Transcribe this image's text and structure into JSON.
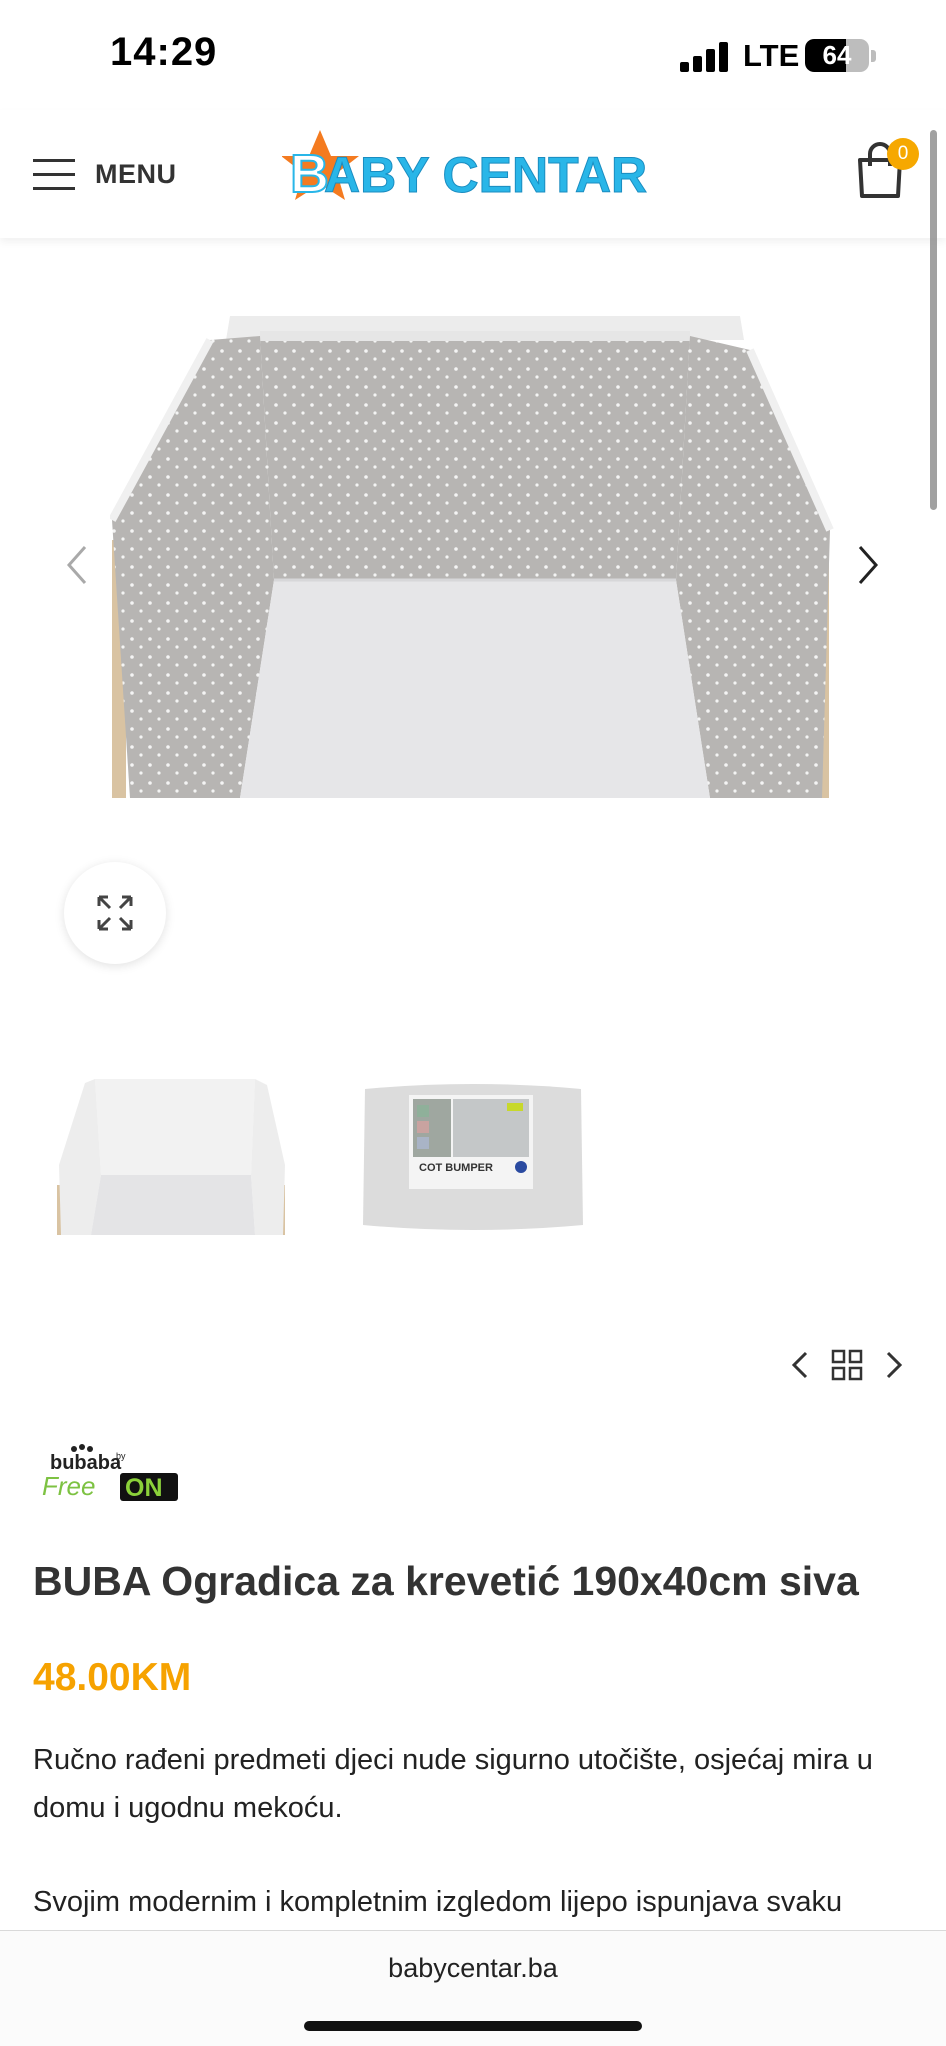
{
  "status_bar": {
    "time": "14:29",
    "network": "LTE",
    "battery": "64",
    "battery_level": 0.64
  },
  "header": {
    "menu_label": "MENU",
    "logo_text": "BABY CENTAR",
    "cart_count": "0",
    "colors": {
      "logo_blue": "#29b6e8",
      "logo_orange": "#f47b20",
      "badge": "#f6a800"
    }
  },
  "gallery": {
    "main_image_alt": "grey crib bumper with white stars",
    "thumbnails": [
      {
        "alt": "white crib bumper"
      },
      {
        "alt": "cot bumper in package",
        "package_label": "COT BUMPER"
      }
    ]
  },
  "product": {
    "brand_logo_text": {
      "top": "bubaba",
      "by": "by",
      "free": "Free",
      "on": "ON"
    },
    "title": "BUBA Ogradica za krevetić 190x40cm siva",
    "price": "48.00KM",
    "description_1": "Ručno rađeni predmeti djeci nude sigurno utočište, osjećaj mira u domu i ugodnu mekoću.",
    "description_2": "Svojim modernim i kompletnim izgledom lijepo ispunjava svaku"
  },
  "browser": {
    "url": "babycentar.ba"
  }
}
